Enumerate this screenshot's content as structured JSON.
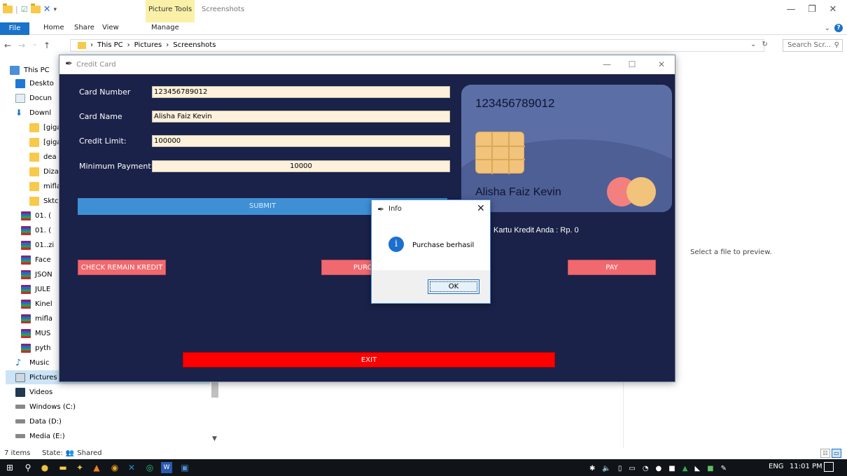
{
  "explorer": {
    "context_tab": "Picture Tools",
    "window_title": "Screenshots",
    "ribbon_tabs": [
      "File",
      "Home",
      "Share",
      "View",
      "Manage"
    ],
    "breadcrumb": [
      "This PC",
      "Pictures",
      "Screenshots"
    ],
    "search_placeholder": "Search Scr...",
    "nav_items": [
      "This PC",
      "Deskto",
      "Docun",
      "Downl",
      "[giga",
      "[giga",
      "dea",
      "Dizat",
      "mifla",
      "Sktcl",
      "01. (",
      "01. (",
      "01..zi",
      "Face",
      "JSON",
      "JULE",
      "Kinel",
      "mifla",
      "MUS",
      "pyth",
      "Music",
      "Pictures",
      "Videos",
      "Windows (C:)",
      "Data (D:)",
      "Media (E:)"
    ],
    "preview_text": "Select a file to preview.",
    "status_items": "7 items",
    "status_state_label": "State:",
    "status_state_value": "Shared"
  },
  "taskbar": {
    "lang": "ENG",
    "clock": "11:01 PM"
  },
  "cc_window": {
    "title": "Credit Card",
    "form": {
      "card_number_label": "Card Number",
      "card_number_value": "123456789012",
      "card_name_label": "Card Name",
      "card_name_value": "Alisha Faiz Kevin",
      "credit_limit_label": "Credit Limit:",
      "credit_limit_value": "100000",
      "min_payment_label": "Minimum Payment:",
      "min_payment_value": "10000"
    },
    "buttons": {
      "submit": "SUBMIT",
      "check_remain": "CHECK REMAIN KREDIT",
      "purchase": "PURCH",
      "pay": "PAY",
      "exit": "EXIT"
    },
    "card": {
      "number": "123456789012",
      "name": "Alisha Faiz Kevin"
    },
    "remain_text": "Kartu Kredit Anda : Rp. 0"
  },
  "dialog": {
    "title": "Info",
    "message": "Purchase berhasil",
    "ok_label": "OK"
  },
  "colors": {
    "app_bg": "#1a2249",
    "input_bg": "#fdf1dc",
    "submit_bg": "#3f8fd4",
    "pink_btn": "#f0696f",
    "exit_btn": "#ff0000",
    "card_bg": "#5b6ea6",
    "chip": "#f2c37a"
  }
}
